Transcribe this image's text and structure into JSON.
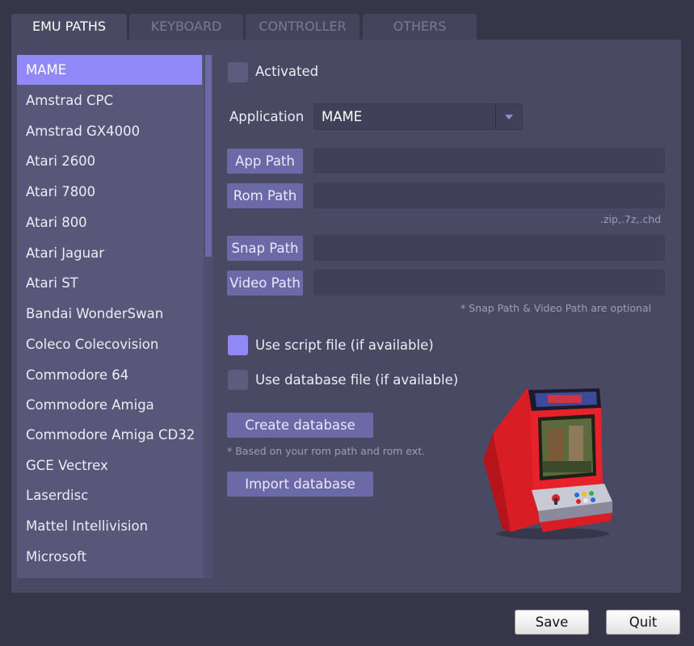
{
  "tabs": [
    {
      "label": "EMU PATHS",
      "active": true
    },
    {
      "label": "KEYBOARD",
      "active": false
    },
    {
      "label": "CONTROLLER",
      "active": false
    },
    {
      "label": "OTHERS",
      "active": false
    }
  ],
  "emulators": [
    "MAME",
    "Amstrad CPC",
    "Amstrad GX4000",
    "Atari 2600",
    "Atari 7800",
    "Atari 800",
    "Atari Jaguar",
    "Atari ST",
    "Bandai WonderSwan",
    "Coleco Colecovision",
    "Commodore 64",
    "Commodore Amiga",
    "Commodore Amiga CD32",
    "GCE Vectrex",
    "Laserdisc",
    "Mattel Intellivision",
    "Microsoft"
  ],
  "selected_emulator": "MAME",
  "settings": {
    "activated_label": "Activated",
    "activated_checked": false,
    "application_label": "Application",
    "application_value": "MAME",
    "app_path_label": "App Path",
    "rom_path_label": "Rom Path",
    "rom_ext_hint": ".zip,.7z,.chd",
    "snap_path_label": "Snap Path",
    "video_path_label": "Video Path",
    "optional_hint": "* Snap Path & Video Path are optional",
    "use_script_label": "Use script file (if available)",
    "use_script_checked": true,
    "use_database_label": "Use database file (if available)",
    "use_database_checked": false,
    "create_db_label": "Create database",
    "create_db_hint": "* Based on your rom path and rom ext.",
    "import_db_label": "Import database"
  },
  "footer": {
    "save_label": "Save",
    "quit_label": "Quit"
  },
  "colors": {
    "background": "#373649",
    "panel": "#4a4963",
    "list_bg": "#58577a",
    "selected": "#9089f7",
    "button": "#6c6aa6",
    "field": "#414058",
    "arcade_red": "#e8222a"
  }
}
